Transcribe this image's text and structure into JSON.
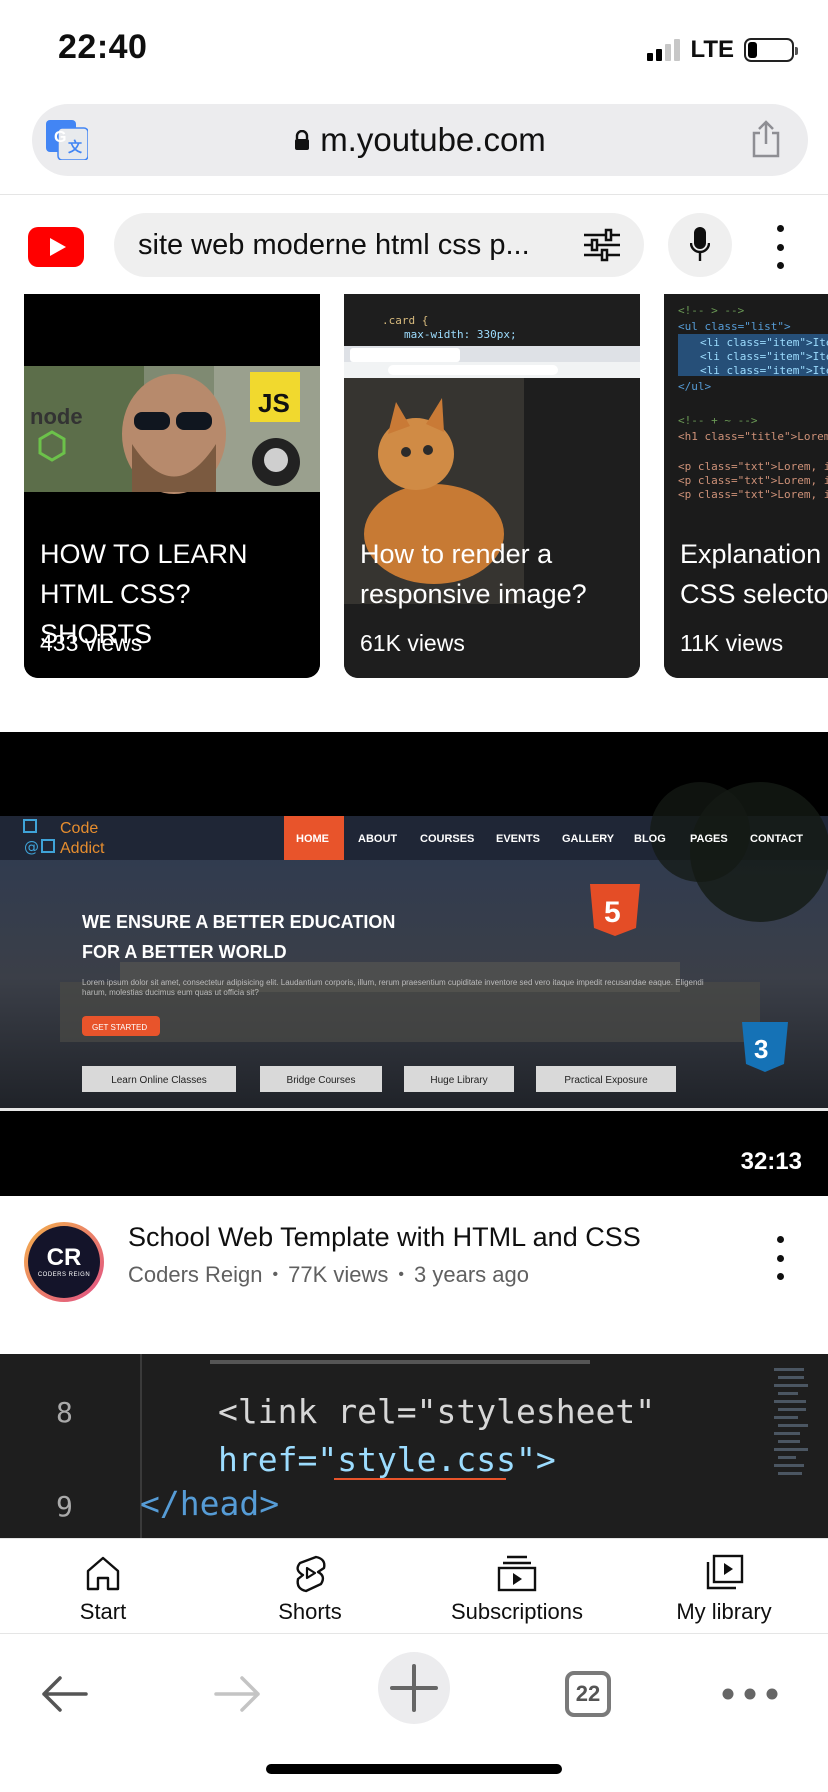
{
  "status_bar": {
    "time": "22:40",
    "network": "LTE"
  },
  "address_bar": {
    "url": "m.youtube.com"
  },
  "header": {
    "search_query": "site web moderne html css p..."
  },
  "shorts": [
    {
      "title": "HOW TO LEARN HTML CSS? SHORTS",
      "views": "433 views",
      "thumb_text": "JS"
    },
    {
      "title": "How to render a responsive image?",
      "views": "61K views",
      "thumb_text": ".card {\n    max-width: 330px;"
    },
    {
      "title": "Explanation complex CSS selectors.",
      "views": "11K views"
    }
  ],
  "main_video": {
    "duration": "32:13",
    "title": "School Web Template with HTML and CSS",
    "channel": "Coders Reign",
    "views": "77K views",
    "age": "3 years ago",
    "avatar_text": "CR",
    "avatar_subtext": "CODERS REIGN",
    "thumbnail": {
      "logo_line1": "Code",
      "logo_line2": "Addict",
      "nav": [
        "HOME",
        "ABOUT",
        "COURSES",
        "EVENTS",
        "GALLERY",
        "BLOG",
        "PAGES",
        "CONTACT"
      ],
      "headline_line1": "WE ENSURE A BETTER EDUCATION",
      "headline_line2": "FOR A BETTER WORLD",
      "body_text": "Lorem ipsum dolor sit amet, consectetur adipisicing elit. Laudantium corporis, illum, rerum praesentium cupiditate inventore sed vero itaque impedit recusandae eaque. Eligendi harum, molestias ducimus eum quas ut officia sit?",
      "cta": "GET STARTED",
      "buttons": [
        "Learn Online Classes",
        "Bridge Courses",
        "Huge Library",
        "Practical Exposure"
      ],
      "html5_badge": "5",
      "css3_badge": "3"
    }
  },
  "code_video": {
    "lines": [
      {
        "num": "8",
        "text": "<link rel=\"stylesheet\""
      },
      {
        "num": "",
        "text": "href=\"style.css\">"
      },
      {
        "num": "9",
        "text": "</head>"
      }
    ]
  },
  "bottom_nav": [
    {
      "label": "Start",
      "icon": "home-icon"
    },
    {
      "label": "Shorts",
      "icon": "shorts-icon"
    },
    {
      "label": "Subscriptions",
      "icon": "subscriptions-icon"
    },
    {
      "label": "My library",
      "icon": "library-icon"
    }
  ],
  "browser_toolbar": {
    "tab_count": "22"
  },
  "colors": {
    "youtube_red": "#ff0000",
    "cta_orange": "#e8542b",
    "html5_orange": "#e44d26",
    "css3_blue": "#1572b6"
  }
}
